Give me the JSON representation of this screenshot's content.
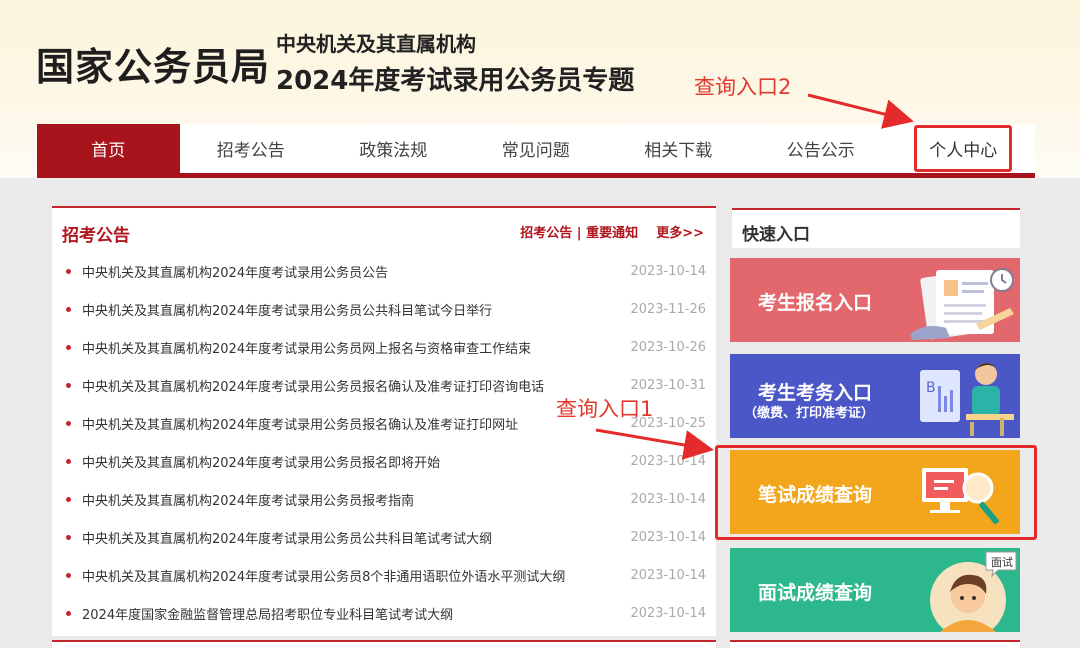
{
  "header": {
    "site_title": "国家公务员局",
    "subtitle_line1": "中央机关及其直属机构",
    "subtitle_line2": "2024年度考试录用公务员专题"
  },
  "nav": {
    "items": [
      {
        "label": "首页"
      },
      {
        "label": "招考公告"
      },
      {
        "label": "政策法规"
      },
      {
        "label": "常见问题"
      },
      {
        "label": "相关下载"
      },
      {
        "label": "公告公示"
      },
      {
        "label": "个人中心"
      }
    ]
  },
  "notice_panel": {
    "title": "招考公告",
    "link_announcements": "招考公告",
    "separator": "|",
    "link_notices": "重要通知",
    "link_more": "更多>>",
    "items": [
      {
        "title": "中央机关及其直属机构2024年度考试录用公务员公告",
        "date": "2023-10-14"
      },
      {
        "title": "中央机关及其直属机构2024年度考试录用公务员公共科目笔试今日举行",
        "date": "2023-11-26"
      },
      {
        "title": "中央机关及其直属机构2024年度考试录用公务员网上报名与资格审查工作结束",
        "date": "2023-10-26"
      },
      {
        "title": "中央机关及其直属机构2024年度考试录用公务员报名确认及准考证打印咨询电话",
        "date": "2023-10-31"
      },
      {
        "title": "中央机关及其直属机构2024年度考试录用公务员报名确认及准考证打印网址",
        "date": "2023-10-25"
      },
      {
        "title": "中央机关及其直属机构2024年度考试录用公务员报名即将开始",
        "date": "2023-10-14"
      },
      {
        "title": "中央机关及其直属机构2024年度考试录用公务员报考指南",
        "date": "2023-10-14"
      },
      {
        "title": "中央机关及其直属机构2024年度考试录用公务员公共科目笔试考试大纲",
        "date": "2023-10-14"
      },
      {
        "title": "中央机关及其直属机构2024年度考试录用公务员8个非通用语职位外语水平测试大纲",
        "date": "2023-10-14"
      },
      {
        "title": "2024年度国家金融监督管理总局招考职位专业科目笔试考试大纲",
        "date": "2023-10-14"
      }
    ]
  },
  "quick_entry": {
    "title": "快速入口",
    "tiles": [
      {
        "label": "考生报名入口",
        "color": "#e2686e"
      },
      {
        "label": "考生考务入口",
        "sub": "（缴费、打印准考证）",
        "color": "#4b56c7"
      },
      {
        "label": "笔试成绩查询",
        "color": "#f3a51b"
      },
      {
        "label": "面试成绩查询",
        "badge": "面试",
        "color": "#2db78c"
      }
    ]
  },
  "annotations": {
    "entry1": "查询入口1",
    "entry2": "查询入口2",
    "highlight_color": "#e42a2a"
  }
}
